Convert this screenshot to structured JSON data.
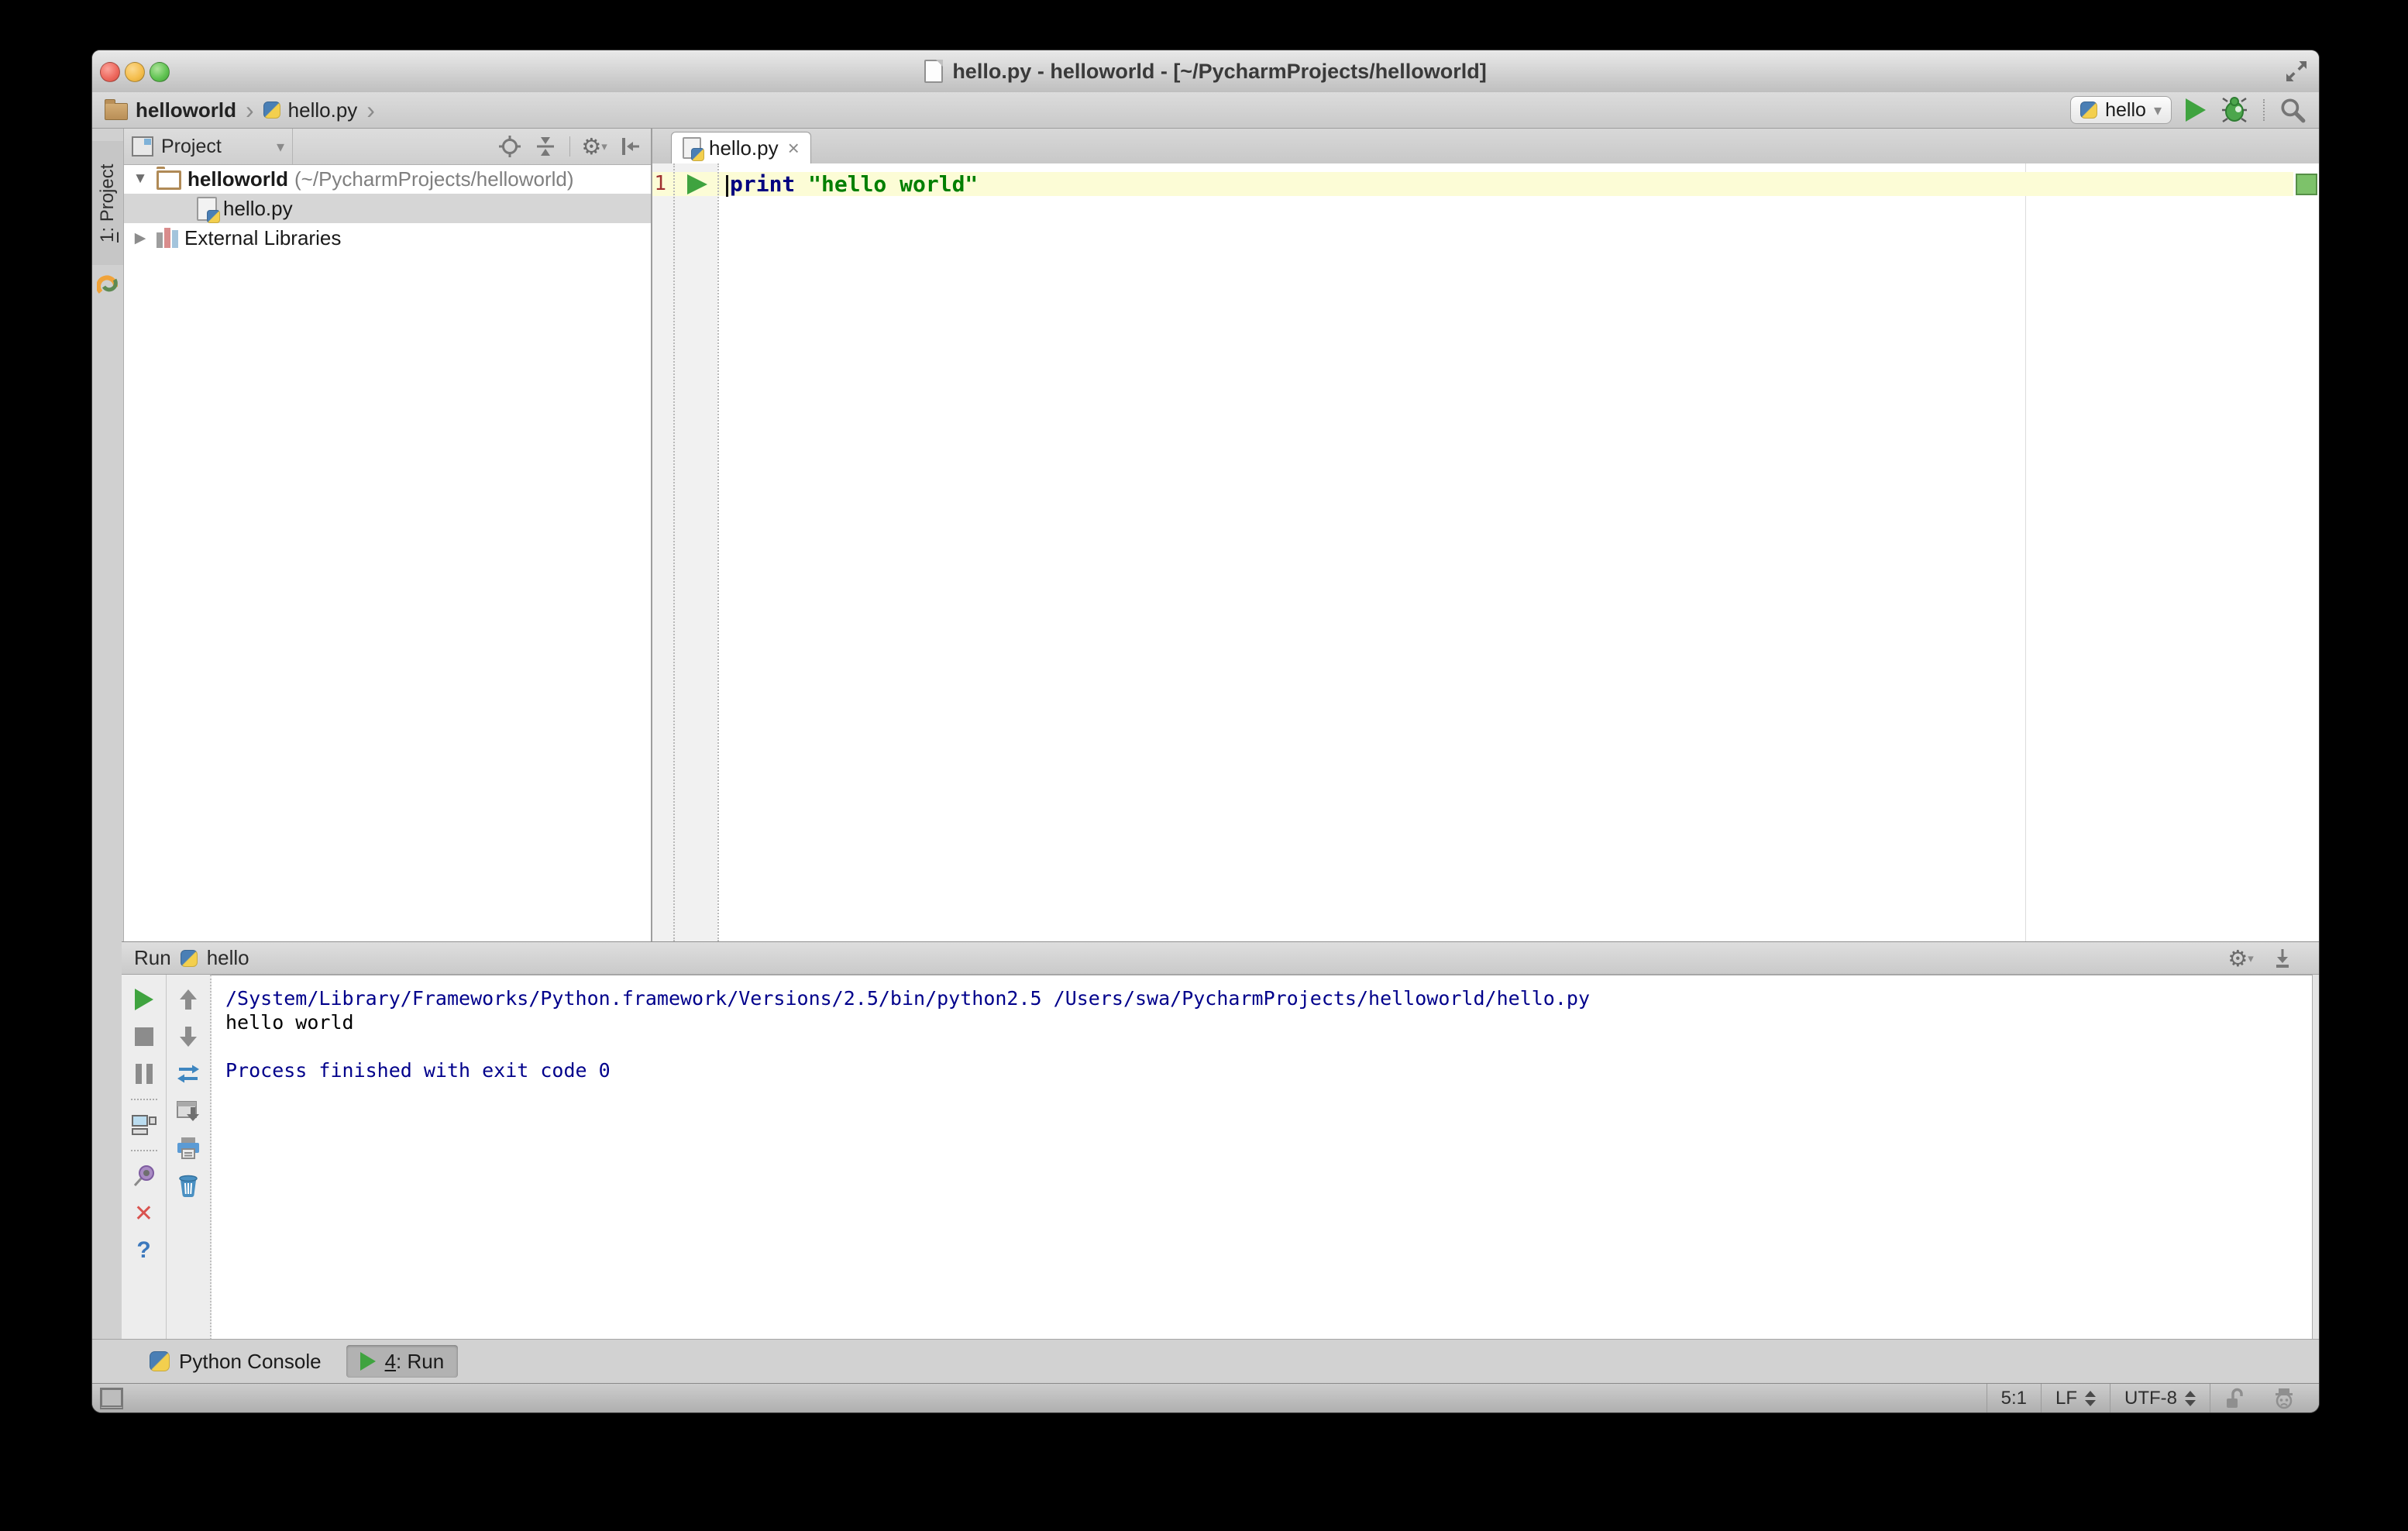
{
  "window": {
    "title": "hello.py - helloworld - [~/PycharmProjects/helloworld]"
  },
  "topbar": {
    "breadcrumbs": [
      {
        "label": "helloworld"
      },
      {
        "label": "hello.py"
      }
    ],
    "run_config_name": "hello"
  },
  "tool_stripe": {
    "mnemonic": "1",
    "label": ": Project"
  },
  "project_panel": {
    "view_selector": "Project",
    "tree": [
      {
        "name": "helloworld",
        "path": " (~/PycharmProjects/helloworld)"
      },
      {
        "name": "hello.py"
      },
      {
        "name": "External Libraries"
      }
    ]
  },
  "editor": {
    "tab_title": "hello.py",
    "line_number": "1",
    "code": {
      "keyword": "print",
      "string": "\"hello world\""
    }
  },
  "run_panel": {
    "title": "Run",
    "config_name": "hello",
    "console_lines": [
      {
        "text": "/System/Library/Frameworks/Python.framework/Versions/2.5/bin/python2.5 /Users/swa/PycharmProjects/helloworld/hello.py",
        "color": "info"
      },
      {
        "text": "hello world",
        "color": "output"
      },
      {
        "text": "",
        "color": "output"
      },
      {
        "text": "Process finished with exit code 0",
        "color": "info"
      }
    ]
  },
  "bottom_bar": {
    "python_console_label": "Python Console",
    "run_tab_mnemonic": "4",
    "run_tab_label": ": Run"
  },
  "status_bar": {
    "caret_position": "5:1",
    "line_separator": "LF",
    "encoding": "UTF-8"
  },
  "icons": {
    "gear": "⚙",
    "dropdown": "▾",
    "chevron": "›",
    "close_tab": "×",
    "tree_expanded": "▼",
    "tree_collapsed": "▶",
    "close_x": "✕",
    "help": "?"
  },
  "colors": {
    "keyword": "#000080",
    "string": "#007F00",
    "console_info": "#00008B",
    "console_output": "#000000",
    "current_line": "#FCFCD6",
    "run_green": "#3FA33F",
    "selection": "#D6D6D6",
    "inspection_ok": "#7DC26A",
    "line_number": "#A03030",
    "desktop": "#000000"
  }
}
